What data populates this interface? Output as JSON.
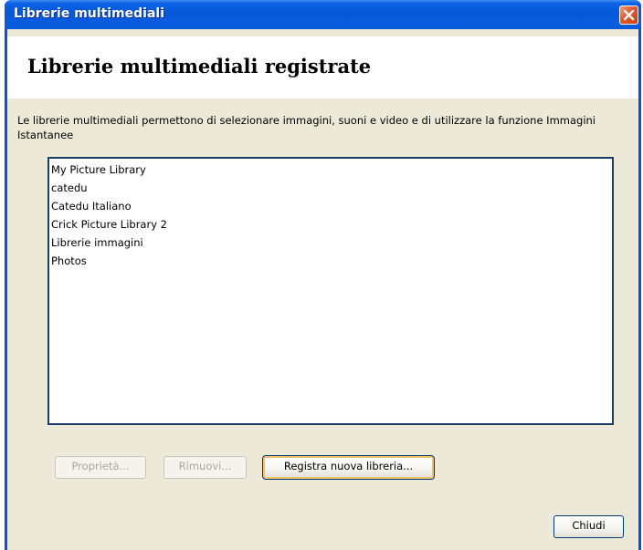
{
  "window": {
    "title": "Librerie multimediali",
    "close_icon": "close-icon",
    "titlebar_color": "#0a5ddf",
    "close_color": "#e2572d"
  },
  "header": {
    "title": "Librerie multimediali registrate"
  },
  "description": "Le librerie multimediali permettono di selezionare immagini, suoni e video e di utilizzare la funzione Immagini Istantanee",
  "libraries": [
    "My Picture Library",
    "catedu",
    "Catedu Italiano",
    "Crick Picture Library 2",
    "Librerie immagini",
    "Photos"
  ],
  "buttons": {
    "properties": "Proprietà...",
    "properties_enabled": false,
    "remove": "Rimuovi...",
    "remove_enabled": false,
    "register": "Registra nuova libreria...",
    "close": "Chiudi"
  }
}
